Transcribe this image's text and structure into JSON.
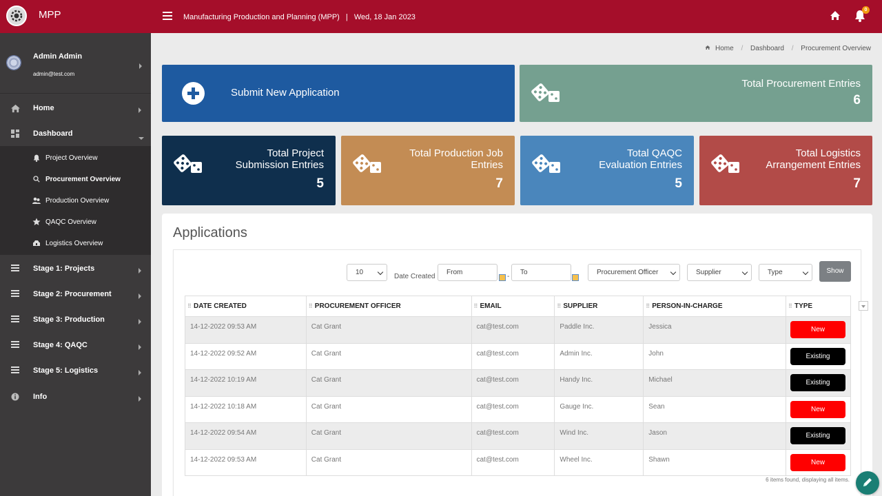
{
  "app": {
    "brand": "MPP",
    "header_title": "Manufacturing Production and Planning (MPP)",
    "header_sep": "|",
    "header_date": "Wed, 18 Jan 2023",
    "notification_count": "0"
  },
  "user": {
    "name": "Admin Admin",
    "email": "admin@test.com"
  },
  "sidebar": {
    "home": "Home",
    "dashboard": "Dashboard",
    "submenu": [
      {
        "label": "Project Overview",
        "icon": "bell-icon"
      },
      {
        "label": "Procurement Overview",
        "icon": "search-icon"
      },
      {
        "label": "Production Overview",
        "icon": "users-icon"
      },
      {
        "label": "QAQC Overview",
        "icon": "star-icon"
      },
      {
        "label": "Logistics Overview",
        "icon": "truck-icon"
      }
    ],
    "stages": [
      "Stage 1: Projects",
      "Stage 2: Procurement",
      "Stage 3: Production",
      "Stage 4: QAQC",
      "Stage 5: Logistics"
    ],
    "info": "Info"
  },
  "breadcrumb": {
    "home": "Home",
    "dashboard": "Dashboard",
    "current": "Procurement Overview"
  },
  "cards": {
    "submit": "Submit New Application",
    "procurement": {
      "title": "Total Procurement Entries",
      "value": "6"
    },
    "project": {
      "title1": "Total Project",
      "title2": "Submission Entries",
      "value": "5"
    },
    "production": {
      "title1": "Total Production Job",
      "title2": "Entries",
      "value": "7"
    },
    "qaqc": {
      "title1": "Total QAQC",
      "title2": "Evaluation Entries",
      "value": "5"
    },
    "logistics": {
      "title1": "Total Logistics",
      "title2": "Arrangement Entries",
      "value": "7"
    }
  },
  "applications": {
    "title": "Applications",
    "filters": {
      "page_size": "10",
      "date_label": "Date Created",
      "from_placeholder": "From",
      "to_placeholder": "To",
      "date_dash": "-",
      "officer": "Procurement Officer",
      "supplier": "Supplier",
      "type": "Type",
      "show": "Show"
    },
    "columns": [
      "DATE CREATED",
      "PROCUREMENT OFFICER",
      "EMAIL",
      "SUPPLIER",
      "PERSON-IN-CHARGE",
      "TYPE"
    ],
    "rows": [
      {
        "date": "14-12-2022 09:53 AM",
        "officer": "Cat Grant",
        "email": "cat@test.com",
        "supplier": "Paddle Inc.",
        "pic": "Jessica",
        "type": "New"
      },
      {
        "date": "14-12-2022 09:52 AM",
        "officer": "Cat Grant",
        "email": "cat@test.com",
        "supplier": "Admin Inc.",
        "pic": "John",
        "type": "Existing"
      },
      {
        "date": "14-12-2022 10:19 AM",
        "officer": "Cat Grant",
        "email": "cat@test.com",
        "supplier": "Handy Inc.",
        "pic": "Michael",
        "type": "Existing"
      },
      {
        "date": "14-12-2022 10:18 AM",
        "officer": "Cat Grant",
        "email": "cat@test.com",
        "supplier": "Gauge Inc.",
        "pic": "Sean",
        "type": "New"
      },
      {
        "date": "14-12-2022 09:54 AM",
        "officer": "Cat Grant",
        "email": "cat@test.com",
        "supplier": "Wind Inc.",
        "pic": "Jason",
        "type": "Existing"
      },
      {
        "date": "14-12-2022 09:53 AM",
        "officer": "Cat Grant",
        "email": "cat@test.com",
        "supplier": "Wheel Inc.",
        "pic": "Shawn",
        "type": "New"
      }
    ],
    "footer": "6 items found, displaying all items."
  },
  "colors": {
    "topbar": "#a50e2a",
    "sidebar": "#3c3a3b",
    "submit": "#1e5aa0",
    "procurement": "#75a090",
    "project": "#0f2f4d",
    "production": "#c38c54",
    "qaqc": "#4a86bc",
    "logistics": "#b24b48",
    "new_badge": "#ff0000",
    "existing_badge": "#000000"
  }
}
